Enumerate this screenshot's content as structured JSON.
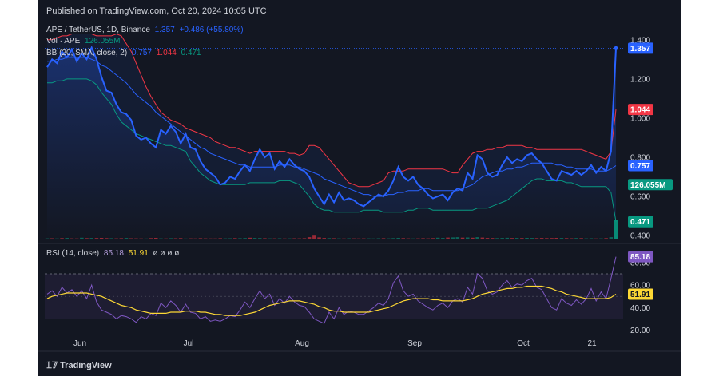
{
  "header": {
    "published": "Published on TradingView.com, Oct 20, 2024 10:05 UTC"
  },
  "legend": {
    "symbol": "APE / TetherUS, 1D, Binance",
    "last": "1.357",
    "change": "+0.486 (+55.80%)",
    "vol_label": "Vol · APE",
    "vol_value": "126.055M",
    "bb_label": "BB (20, SMA, close, 2)",
    "bb_basis": "0.757",
    "bb_upper": "1.044",
    "bb_lower": "0.471",
    "rsi_label": "RSI (14, close)",
    "rsi_value": "85.18",
    "rsi_ma": "51.91",
    "rsi_empty": "ø ø ø ø"
  },
  "footer": {
    "brand": "TradingView"
  },
  "colors": {
    "background": "#131722",
    "price": "#2962ff",
    "bb_basis": "#2962ff",
    "bb_upper": "#f23645",
    "bb_lower": "#089981",
    "bb_fill": "#2962ff",
    "volume_up": "#089981",
    "volume_down": "#f23645",
    "rsi": "#7e57c2",
    "rsi_ma": "#fdd835"
  },
  "chart_data": [
    {
      "type": "line",
      "name": "price-panel",
      "x_labels": [
        "Jun",
        "Jul",
        "Aug",
        "Sep",
        "Oct",
        "21"
      ],
      "ylim": [
        0.38,
        1.44
      ],
      "y_ticks": [
        "1.400",
        "1.200",
        "1.000",
        "0.800",
        "0.600",
        "0.400"
      ],
      "price_badges": [
        {
          "value": "1.357",
          "color": "#2962ff",
          "y": 1.357
        },
        {
          "value": "1.044",
          "color": "#f23645",
          "y": 1.044
        },
        {
          "value": "0.757",
          "color": "#2962ff",
          "y": 0.757
        },
        {
          "value": "126.055M",
          "color": "#089981",
          "y": 0.66
        },
        {
          "value": "0.471",
          "color": "#089981",
          "y": 0.471
        }
      ],
      "series": [
        {
          "key": "close",
          "values": [
            1.26,
            1.3,
            1.28,
            1.34,
            1.31,
            1.35,
            1.29,
            1.33,
            1.3,
            1.36,
            1.3,
            1.21,
            1.14,
            1.13,
            1.07,
            1.03,
            1.02,
            0.99,
            0.91,
            0.89,
            0.9,
            0.87,
            0.85,
            0.94,
            0.92,
            0.96,
            0.93,
            0.87,
            0.92,
            0.85,
            0.84,
            0.78,
            0.74,
            0.72,
            0.7,
            0.66,
            0.67,
            0.7,
            0.69,
            0.73,
            0.76,
            0.73,
            0.79,
            0.84,
            0.8,
            0.82,
            0.74,
            0.78,
            0.75,
            0.79,
            0.76,
            0.74,
            0.73,
            0.7,
            0.64,
            0.6,
            0.56,
            0.61,
            0.57,
            0.62,
            0.58,
            0.59,
            0.58,
            0.56,
            0.55,
            0.57,
            0.59,
            0.61,
            0.6,
            0.63,
            0.68,
            0.75,
            0.7,
            0.68,
            0.7,
            0.66,
            0.64,
            0.61,
            0.59,
            0.6,
            0.61,
            0.58,
            0.62,
            0.64,
            0.63,
            0.72,
            0.69,
            0.81,
            0.79,
            0.72,
            0.7,
            0.71,
            0.76,
            0.8,
            0.77,
            0.79,
            0.78,
            0.81,
            0.82,
            0.79,
            0.77,
            0.73,
            0.69,
            0.68,
            0.73,
            0.72,
            0.71,
            0.73,
            0.71,
            0.73,
            0.76,
            0.72,
            0.75,
            0.73,
            0.83,
            1.357
          ]
        },
        {
          "key": "bb_upper",
          "values": [
            1.4,
            1.4,
            1.41,
            1.42,
            1.42,
            1.43,
            1.43,
            1.43,
            1.43,
            1.43,
            1.42,
            1.42,
            1.42,
            1.42,
            1.43,
            1.42,
            1.38,
            1.34,
            1.28,
            1.22,
            1.16,
            1.11,
            1.07,
            1.03,
            1.01,
            0.99,
            0.98,
            0.97,
            0.95,
            0.94,
            0.93,
            0.92,
            0.91,
            0.9,
            0.88,
            0.87,
            0.86,
            0.85,
            0.85,
            0.84,
            0.83,
            0.82,
            0.83,
            0.83,
            0.83,
            0.83,
            0.83,
            0.83,
            0.83,
            0.82,
            0.82,
            0.81,
            0.82,
            0.86,
            0.86,
            0.85,
            0.82,
            0.79,
            0.76,
            0.73,
            0.7,
            0.67,
            0.66,
            0.65,
            0.65,
            0.65,
            0.66,
            0.67,
            0.68,
            0.72,
            0.73,
            0.73,
            0.73,
            0.74,
            0.74,
            0.74,
            0.74,
            0.74,
            0.74,
            0.74,
            0.74,
            0.73,
            0.72,
            0.72,
            0.76,
            0.79,
            0.82,
            0.83,
            0.83,
            0.84,
            0.84,
            0.85,
            0.85,
            0.86,
            0.86,
            0.86,
            0.86,
            0.85,
            0.85,
            0.84,
            0.84,
            0.84,
            0.84,
            0.84,
            0.84,
            0.84,
            0.84,
            0.84,
            0.84,
            0.83,
            0.82,
            0.81,
            0.8,
            0.79,
            0.83,
            1.044
          ]
        },
        {
          "key": "bb_basis",
          "values": [
            1.29,
            1.29,
            1.3,
            1.3,
            1.31,
            1.31,
            1.31,
            1.31,
            1.31,
            1.3,
            1.29,
            1.27,
            1.26,
            1.24,
            1.22,
            1.2,
            1.18,
            1.15,
            1.12,
            1.1,
            1.08,
            1.06,
            1.03,
            1.01,
            0.99,
            0.97,
            0.95,
            0.93,
            0.91,
            0.89,
            0.87,
            0.85,
            0.84,
            0.82,
            0.81,
            0.8,
            0.79,
            0.78,
            0.77,
            0.76,
            0.76,
            0.75,
            0.75,
            0.75,
            0.75,
            0.75,
            0.75,
            0.76,
            0.76,
            0.76,
            0.75,
            0.75,
            0.74,
            0.73,
            0.72,
            0.71,
            0.69,
            0.68,
            0.67,
            0.66,
            0.65,
            0.64,
            0.63,
            0.62,
            0.61,
            0.61,
            0.6,
            0.6,
            0.6,
            0.61,
            0.61,
            0.62,
            0.62,
            0.63,
            0.63,
            0.63,
            0.64,
            0.64,
            0.63,
            0.63,
            0.63,
            0.63,
            0.63,
            0.63,
            0.64,
            0.65,
            0.66,
            0.68,
            0.7,
            0.71,
            0.72,
            0.73,
            0.73,
            0.74,
            0.74,
            0.75,
            0.75,
            0.76,
            0.77,
            0.77,
            0.77,
            0.77,
            0.77,
            0.76,
            0.76,
            0.75,
            0.75,
            0.74,
            0.74,
            0.74,
            0.74,
            0.73,
            0.73,
            0.73,
            0.74,
            0.757
          ]
        },
        {
          "key": "bb_lower",
          "values": [
            1.18,
            1.18,
            1.19,
            1.19,
            1.2,
            1.2,
            1.2,
            1.2,
            1.2,
            1.19,
            1.17,
            1.13,
            1.1,
            1.07,
            1.02,
            0.98,
            0.96,
            0.94,
            0.92,
            0.91,
            0.9,
            0.89,
            0.88,
            0.87,
            0.86,
            0.86,
            0.85,
            0.84,
            0.83,
            0.78,
            0.75,
            0.72,
            0.7,
            0.68,
            0.67,
            0.66,
            0.66,
            0.66,
            0.66,
            0.66,
            0.66,
            0.67,
            0.67,
            0.67,
            0.67,
            0.67,
            0.67,
            0.68,
            0.68,
            0.68,
            0.67,
            0.66,
            0.63,
            0.6,
            0.56,
            0.54,
            0.53,
            0.53,
            0.52,
            0.52,
            0.52,
            0.52,
            0.52,
            0.52,
            0.53,
            0.53,
            0.53,
            0.53,
            0.52,
            0.52,
            0.52,
            0.52,
            0.52,
            0.53,
            0.53,
            0.54,
            0.54,
            0.54,
            0.53,
            0.53,
            0.53,
            0.53,
            0.53,
            0.53,
            0.53,
            0.53,
            0.53,
            0.54,
            0.54,
            0.54,
            0.55,
            0.56,
            0.57,
            0.58,
            0.6,
            0.62,
            0.64,
            0.66,
            0.68,
            0.69,
            0.69,
            0.68,
            0.68,
            0.68,
            0.68,
            0.67,
            0.67,
            0.66,
            0.65,
            0.65,
            0.65,
            0.65,
            0.65,
            0.65,
            0.62,
            0.471
          ]
        }
      ],
      "volume_fraction": [
        0.3,
        0.32,
        0.28,
        0.35,
        0.4,
        0.3,
        0.28,
        0.45,
        0.35,
        0.4,
        0.38,
        0.42,
        0.36,
        0.34,
        0.3,
        0.33,
        0.4,
        0.32,
        0.3,
        0.28,
        0.26,
        0.35,
        0.42,
        0.3,
        0.28,
        0.33,
        0.32,
        0.35,
        0.26,
        0.3,
        0.28,
        0.33,
        0.3,
        0.28,
        0.27,
        0.33,
        0.3,
        0.32,
        0.36,
        0.34,
        0.38,
        0.45,
        0.4,
        0.38,
        0.33,
        0.3,
        0.3,
        0.32,
        0.28,
        0.3,
        0.32,
        0.3,
        0.33,
        0.6,
        1.0,
        0.55,
        0.4,
        0.35,
        0.33,
        0.3,
        0.28,
        0.32,
        0.3,
        0.28,
        0.3,
        0.3,
        0.28,
        0.32,
        0.33,
        0.3,
        0.35,
        0.42,
        0.35,
        0.3,
        0.28,
        0.3,
        0.33,
        0.3,
        0.36,
        0.45,
        0.4,
        0.5,
        0.55,
        0.6,
        0.48,
        0.52,
        0.45,
        0.6,
        0.5,
        0.4,
        0.38,
        0.35,
        0.4,
        0.44,
        0.38,
        0.4,
        0.38,
        0.42,
        0.4,
        0.36,
        0.4,
        0.35,
        0.38,
        0.42,
        0.4,
        0.35,
        0.32,
        0.38,
        0.35,
        0.3,
        0.32,
        0.28,
        0.3,
        0.35,
        0.6,
        5.0
      ],
      "volume_up": [
        1,
        0,
        1,
        0,
        1,
        0,
        0,
        1,
        0,
        1,
        0,
        0,
        0,
        1,
        0,
        0,
        1,
        0,
        0,
        0,
        1,
        0,
        0,
        1,
        0,
        1,
        0,
        0,
        1,
        0,
        0,
        0,
        0,
        0,
        0,
        0,
        1,
        1,
        0,
        1,
        1,
        0,
        1,
        1,
        0,
        1,
        0,
        1,
        0,
        1,
        0,
        0,
        0,
        0,
        0,
        0,
        0,
        1,
        0,
        1,
        0,
        1,
        0,
        0,
        0,
        1,
        1,
        1,
        0,
        1,
        1,
        1,
        0,
        0,
        1,
        0,
        0,
        0,
        0,
        1,
        1,
        0,
        1,
        1,
        0,
        1,
        0,
        1,
        0,
        0,
        0,
        1,
        1,
        1,
        0,
        1,
        0,
        1,
        1,
        0,
        0,
        0,
        0,
        0,
        1,
        0,
        0,
        1,
        0,
        1,
        1,
        0,
        1,
        0,
        1,
        1
      ]
    },
    {
      "type": "line",
      "name": "rsi-panel",
      "ylim": [
        14,
        92
      ],
      "y_ticks": [
        "80.00",
        "60.00",
        "40.00",
        "20.00"
      ],
      "bands": [
        30,
        70
      ],
      "badges": [
        {
          "value": "85.18",
          "color": "#7e57c2",
          "y": 85.18
        },
        {
          "value": "51.91",
          "color": "#fdd835",
          "y": 51.91
        }
      ],
      "series": [
        {
          "key": "rsi",
          "values": [
            52,
            55,
            50,
            58,
            53,
            56,
            50,
            55,
            48,
            60,
            45,
            38,
            36,
            34,
            30,
            33,
            32,
            30,
            27,
            32,
            30,
            35,
            33,
            44,
            40,
            46,
            42,
            36,
            43,
            36,
            35,
            30,
            32,
            28,
            29,
            28,
            30,
            33,
            32,
            38,
            45,
            40,
            48,
            55,
            48,
            52,
            42,
            48,
            44,
            50,
            45,
            42,
            41,
            36,
            30,
            28,
            26,
            36,
            30,
            40,
            34,
            37,
            36,
            34,
            34,
            37,
            40,
            44,
            42,
            48,
            62,
            68,
            55,
            50,
            52,
            46,
            43,
            40,
            38,
            42,
            44,
            40,
            46,
            48,
            45,
            58,
            52,
            70,
            66,
            55,
            52,
            54,
            60,
            64,
            58,
            61,
            60,
            64,
            66,
            58,
            56,
            48,
            40,
            38,
            48,
            44,
            42,
            47,
            43,
            48,
            57,
            46,
            54,
            48,
            66,
            85.18
          ]
        },
        {
          "key": "rsi_ma",
          "values": [
            48,
            50,
            51,
            52,
            53,
            53,
            53,
            53,
            53,
            52,
            51,
            50,
            48,
            46,
            44,
            42,
            41,
            40,
            38,
            37,
            36,
            35,
            35,
            35,
            35,
            36,
            36,
            36,
            37,
            37,
            37,
            36,
            36,
            35,
            34,
            34,
            33,
            33,
            33,
            33,
            34,
            35,
            36,
            38,
            40,
            42,
            43,
            44,
            45,
            46,
            46,
            46,
            45,
            44,
            43,
            41,
            40,
            38,
            37,
            37,
            36,
            36,
            36,
            36,
            36,
            36,
            37,
            38,
            39,
            40,
            42,
            44,
            46,
            47,
            48,
            48,
            48,
            48,
            47,
            47,
            46,
            46,
            46,
            46,
            46,
            47,
            48,
            50,
            52,
            53,
            54,
            55,
            56,
            57,
            57,
            58,
            58,
            59,
            59,
            59,
            59,
            58,
            57,
            55,
            54,
            52,
            51,
            50,
            49,
            48,
            48,
            48,
            48,
            48,
            49,
            51.91
          ]
        }
      ]
    }
  ]
}
